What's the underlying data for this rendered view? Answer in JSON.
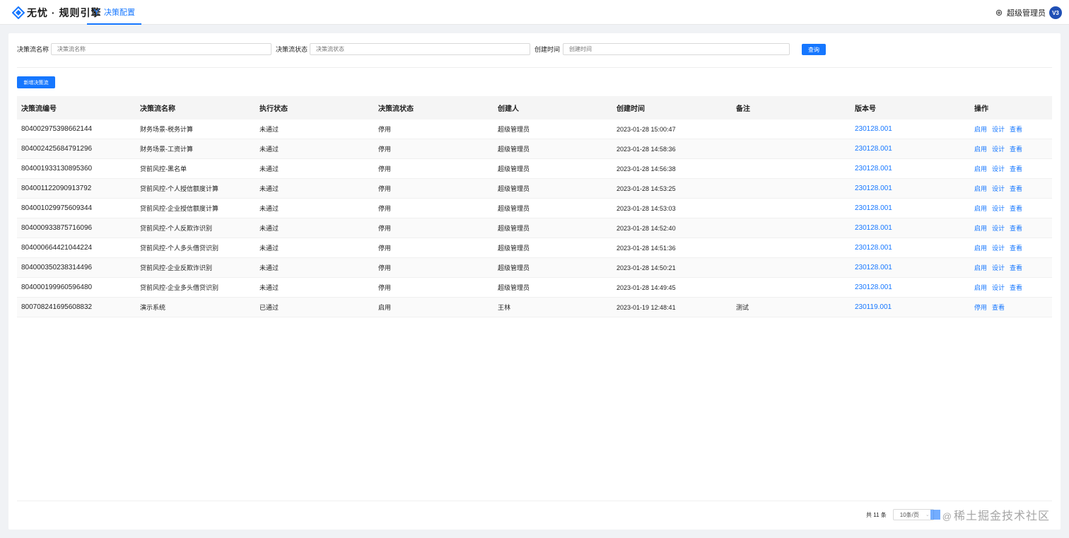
{
  "app": {
    "title": "无忧 · 规则引擎",
    "logo_icon": "diamond-logo-icon",
    "nav_tab": "决策配置",
    "user_name": "超级管理员",
    "avatar_text": "V3",
    "accent": "#1677ff"
  },
  "filters": {
    "name_label": "决策流名称",
    "name_placeholder": "决策流名称",
    "status_label": "决策流状态",
    "status_placeholder": "决策流状态",
    "time_label": "创建时间",
    "time_placeholder": "创建时间",
    "query_label": "查询"
  },
  "toolbar": {
    "add_label": "新增决策流"
  },
  "table": {
    "columns": [
      "决策流编号",
      "决策流名称",
      "执行状态",
      "决策流状态",
      "创建人",
      "创建时间",
      "备注",
      "版本号",
      "操作"
    ],
    "rows": [
      {
        "id": "804002975398662144",
        "name": "财务场景-税务计算",
        "exec": "未通过",
        "status": "停用",
        "creator": "超级管理员",
        "created": "2023-01-28 15:00:47",
        "remark": "",
        "version": "230128.001",
        "ops": [
          "启用",
          "设计",
          "查看"
        ]
      },
      {
        "id": "804002425684791296",
        "name": "财务场景-工资计算",
        "exec": "未通过",
        "status": "停用",
        "creator": "超级管理员",
        "created": "2023-01-28 14:58:36",
        "remark": "",
        "version": "230128.001",
        "ops": [
          "启用",
          "设计",
          "查看"
        ]
      },
      {
        "id": "804001933130895360",
        "name": "贷前风控-黑名单",
        "exec": "未通过",
        "status": "停用",
        "creator": "超级管理员",
        "created": "2023-01-28 14:56:38",
        "remark": "",
        "version": "230128.001",
        "ops": [
          "启用",
          "设计",
          "查看"
        ]
      },
      {
        "id": "804001122090913792",
        "name": "贷前风控-个人授信额度计算",
        "exec": "未通过",
        "status": "停用",
        "creator": "超级管理员",
        "created": "2023-01-28 14:53:25",
        "remark": "",
        "version": "230128.001",
        "ops": [
          "启用",
          "设计",
          "查看"
        ]
      },
      {
        "id": "804001029975609344",
        "name": "贷前风控-企业授信额度计算",
        "exec": "未通过",
        "status": "停用",
        "creator": "超级管理员",
        "created": "2023-01-28 14:53:03",
        "remark": "",
        "version": "230128.001",
        "ops": [
          "启用",
          "设计",
          "查看"
        ]
      },
      {
        "id": "804000933875716096",
        "name": "贷前风控-个人反欺诈识别",
        "exec": "未通过",
        "status": "停用",
        "creator": "超级管理员",
        "created": "2023-01-28 14:52:40",
        "remark": "",
        "version": "230128.001",
        "ops": [
          "启用",
          "设计",
          "查看"
        ]
      },
      {
        "id": "804000664421044224",
        "name": "贷前风控-个人多头借贷识别",
        "exec": "未通过",
        "status": "停用",
        "creator": "超级管理员",
        "created": "2023-01-28 14:51:36",
        "remark": "",
        "version": "230128.001",
        "ops": [
          "启用",
          "设计",
          "查看"
        ]
      },
      {
        "id": "804000350238314496",
        "name": "贷前风控-企业反欺诈识别",
        "exec": "未通过",
        "status": "停用",
        "creator": "超级管理员",
        "created": "2023-01-28 14:50:21",
        "remark": "",
        "version": "230128.001",
        "ops": [
          "启用",
          "设计",
          "查看"
        ]
      },
      {
        "id": "804000199960596480",
        "name": "贷前风控-企业多头借贷识别",
        "exec": "未通过",
        "status": "停用",
        "creator": "超级管理员",
        "created": "2023-01-28 14:49:45",
        "remark": "",
        "version": "230128.001",
        "ops": [
          "启用",
          "设计",
          "查看"
        ]
      },
      {
        "id": "800708241695608832",
        "name": "演示系统",
        "exec": "已通过",
        "status": "启用",
        "creator": "王林",
        "created": "2023-01-19 12:48:41",
        "remark": "测试",
        "version": "230119.001",
        "ops": [
          "停用",
          "查看"
        ]
      }
    ]
  },
  "pager": {
    "total": "共 11 条",
    "page_size": "10条/页",
    "watermark": "稀土掘金技术社区"
  }
}
